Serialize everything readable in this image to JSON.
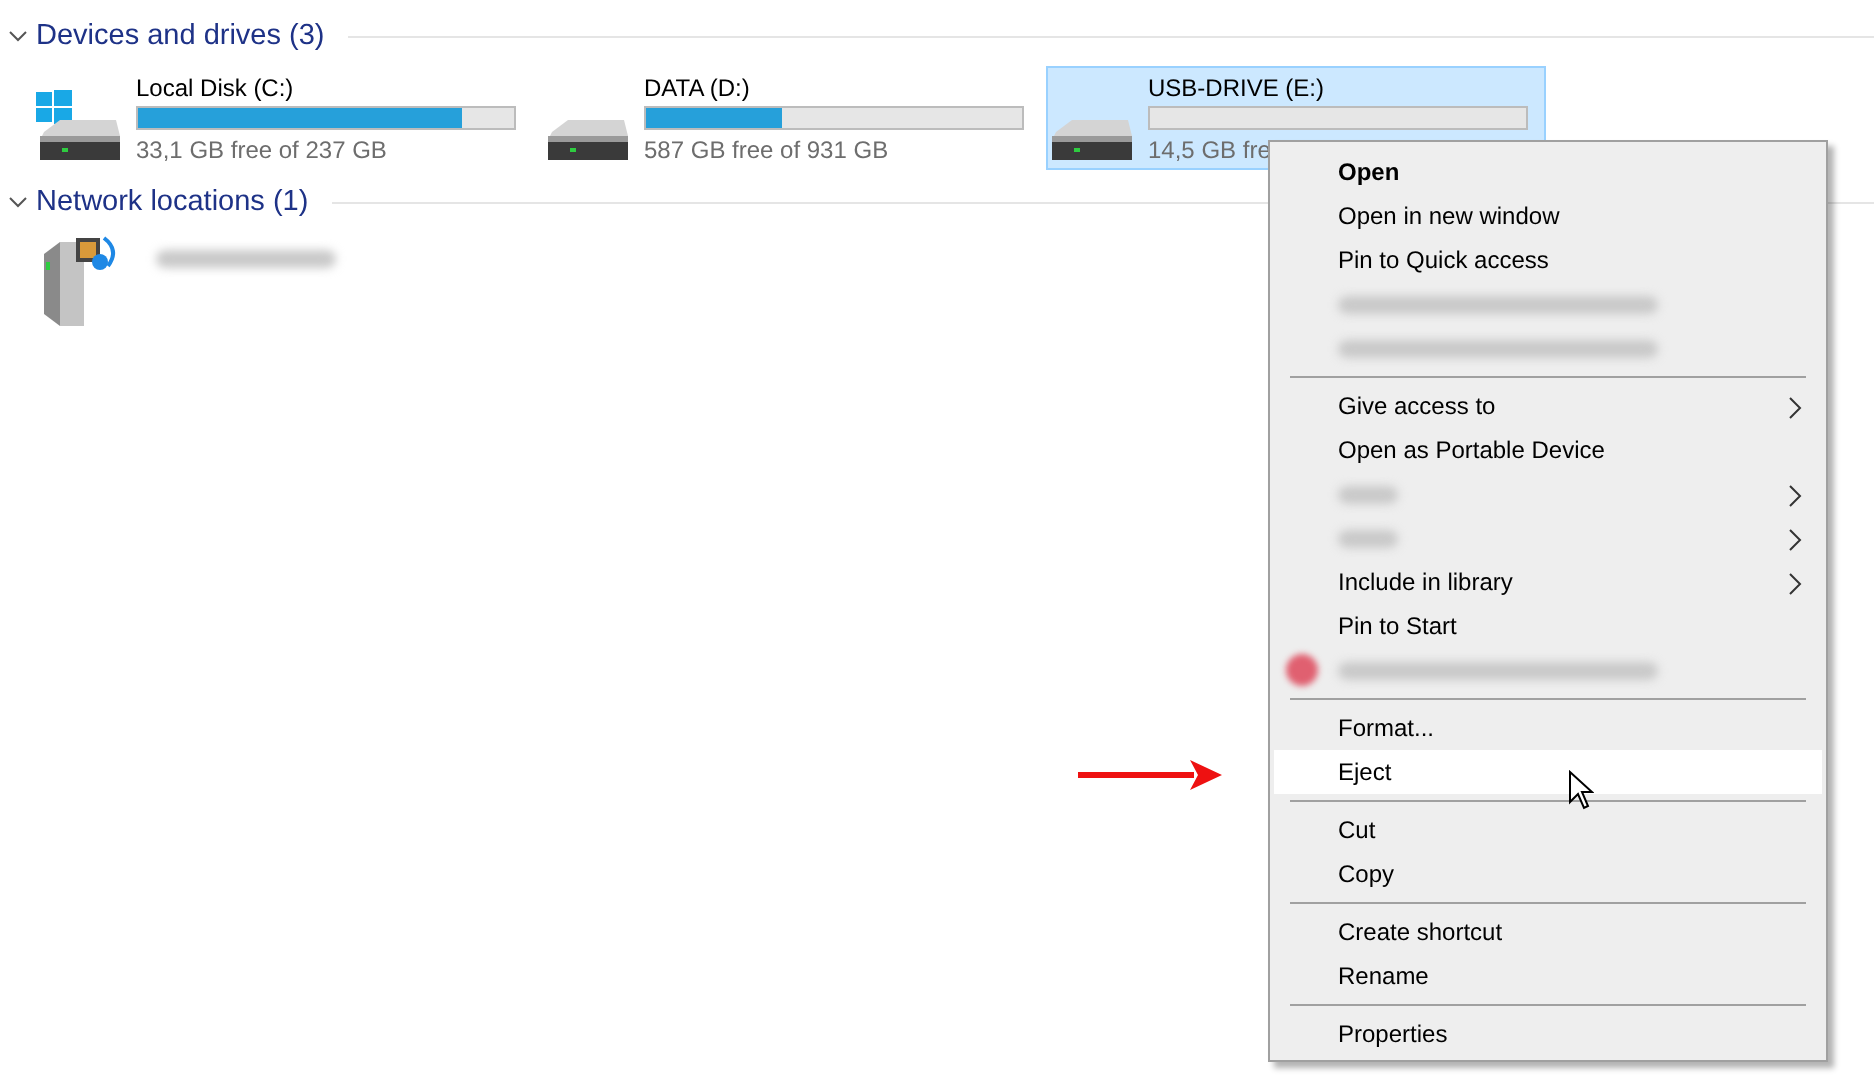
{
  "sections": [
    {
      "title": "Devices and drives (3)",
      "expanded": true,
      "kind": "drives",
      "items": [
        {
          "name": "Local Disk (C:)",
          "free": "33,1 GB free of 237 GB",
          "level": 0.86,
          "system": true,
          "selected": false
        },
        {
          "name": "DATA (D:)",
          "free": "587 GB free of 931 GB",
          "level": 0.36,
          "system": false,
          "selected": false
        },
        {
          "name": "USB-DRIVE (E:)",
          "free": "14,5 GB fre",
          "level": 0,
          "system": false,
          "selected": true
        }
      ]
    },
    {
      "title": "Network locations (1)",
      "expanded": true,
      "kind": "network",
      "items": [
        {
          "kind": "redacted"
        }
      ]
    }
  ],
  "context_menu": {
    "items": [
      {
        "kind": "item",
        "label": "Open",
        "default": true,
        "highlighted": false,
        "submenu": false
      },
      {
        "kind": "item",
        "label": "Open in new window",
        "default": false,
        "highlighted": false,
        "submenu": false
      },
      {
        "kind": "item",
        "label": "Pin to Quick access",
        "default": false,
        "highlighted": false,
        "submenu": false
      },
      {
        "kind": "redacted",
        "submenu": false,
        "has_icon": false
      },
      {
        "kind": "redacted",
        "submenu": false,
        "has_icon": false
      },
      {
        "kind": "separator"
      },
      {
        "kind": "item",
        "label": "Give access to",
        "default": false,
        "highlighted": false,
        "submenu": true
      },
      {
        "kind": "item",
        "label": "Open as Portable Device",
        "default": false,
        "highlighted": false,
        "submenu": false
      },
      {
        "kind": "redacted",
        "submenu": true,
        "has_icon": false
      },
      {
        "kind": "redacted",
        "submenu": true,
        "has_icon": false
      },
      {
        "kind": "item",
        "label": "Include in library",
        "default": false,
        "highlighted": false,
        "submenu": true
      },
      {
        "kind": "item",
        "label": "Pin to Start",
        "default": false,
        "highlighted": false,
        "submenu": false
      },
      {
        "kind": "redacted",
        "submenu": false,
        "has_icon": true
      },
      {
        "kind": "separator"
      },
      {
        "kind": "item",
        "label": "Format...",
        "default": false,
        "highlighted": false,
        "submenu": false
      },
      {
        "kind": "item",
        "label": "Eject",
        "default": false,
        "highlighted": true,
        "submenu": false
      },
      {
        "kind": "separator"
      },
      {
        "kind": "item",
        "label": "Cut",
        "default": false,
        "highlighted": false,
        "submenu": false
      },
      {
        "kind": "item",
        "label": "Copy",
        "default": false,
        "highlighted": false,
        "submenu": false
      },
      {
        "kind": "separator"
      },
      {
        "kind": "item",
        "label": "Create shortcut",
        "default": false,
        "highlighted": false,
        "submenu": false
      },
      {
        "kind": "item",
        "label": "Rename",
        "default": false,
        "highlighted": false,
        "submenu": false
      },
      {
        "kind": "separator"
      },
      {
        "kind": "item",
        "label": "Properties",
        "default": false,
        "highlighted": false,
        "submenu": false
      }
    ]
  }
}
